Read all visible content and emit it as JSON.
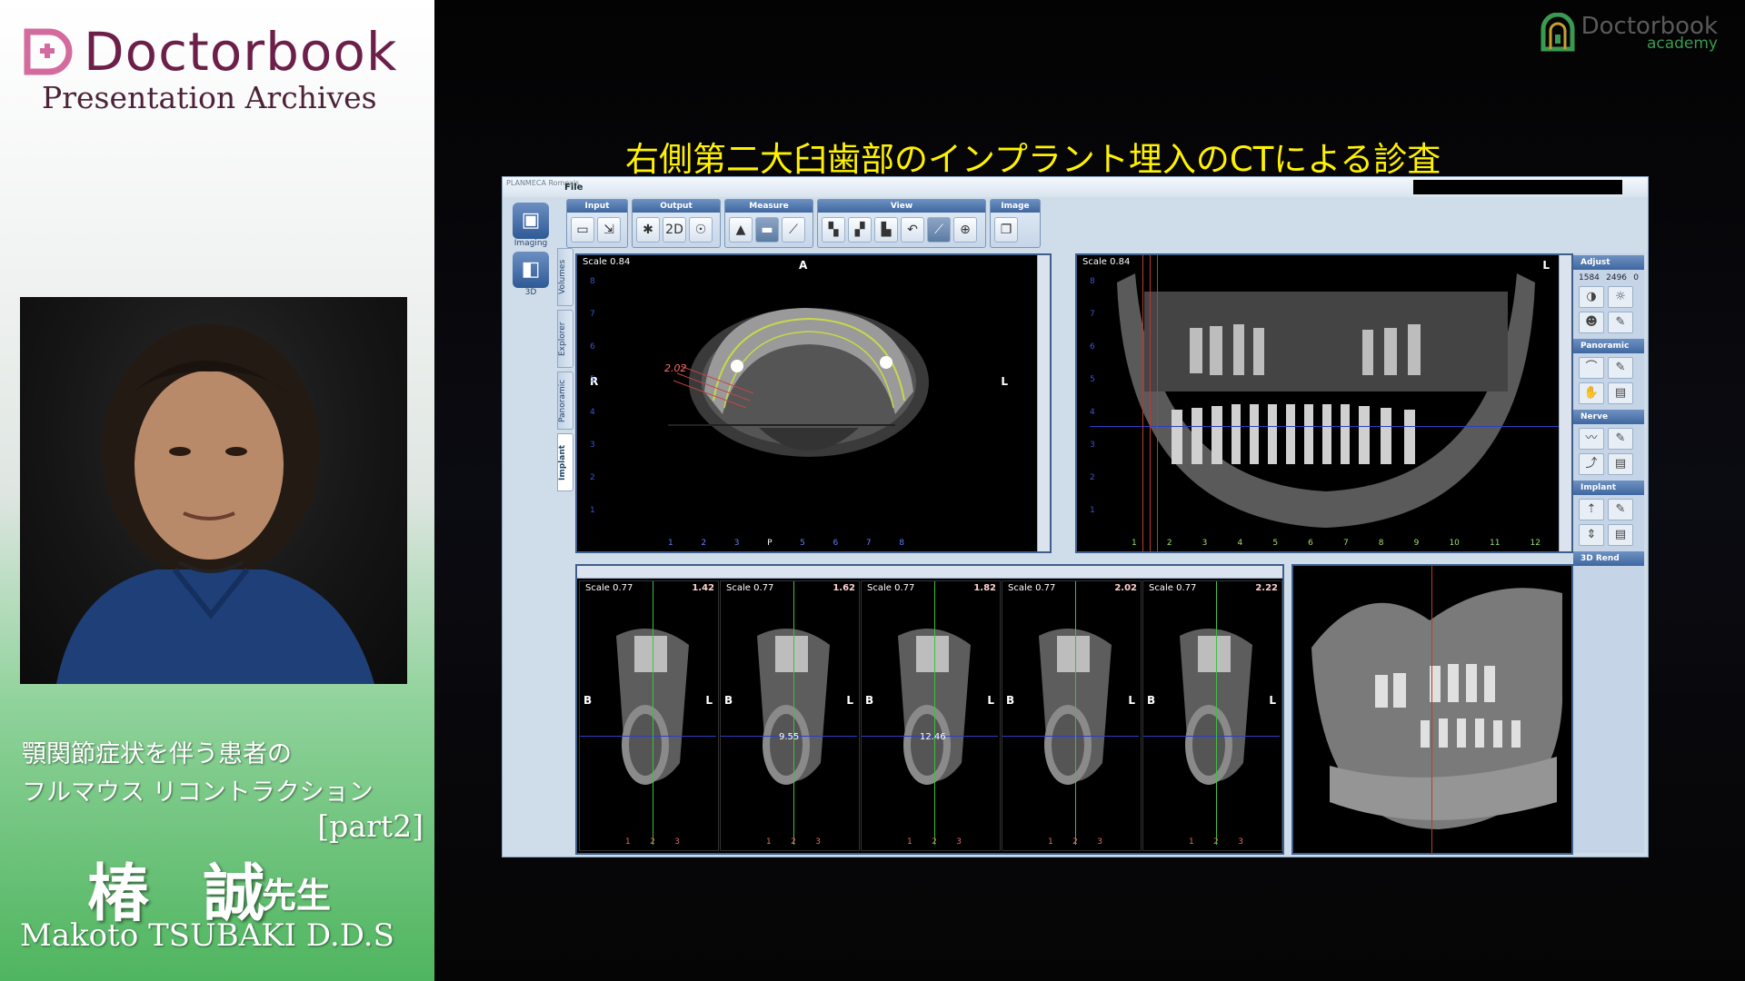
{
  "branding": {
    "name": "Doctorbook",
    "subtitle": "Presentation Archives",
    "academy_line1": "Doctorbook",
    "academy_line2": "academy"
  },
  "talk": {
    "title_line1": "顎関節症状を伴う患者の",
    "title_line2": "フルマウス リコントラクション",
    "part": "[part2]",
    "presenter_ja": "椿 誠",
    "honorific": "先生",
    "presenter_en": "Makoto TSUBAKI D.D.S"
  },
  "slide": {
    "title": "右側第二大臼歯部のインプラント埋入のCTによる診査"
  },
  "app": {
    "vendor": "PLANMECA Romexis",
    "menu": {
      "file": "File"
    },
    "toolbar_groups": [
      {
        "label": "Input",
        "buttons": [
          "open-folder-icon",
          "import-icon"
        ]
      },
      {
        "label": "Output",
        "buttons": [
          "xray-icon",
          "2d-icon",
          "skull-icon"
        ]
      },
      {
        "label": "Measure",
        "buttons": [
          "image-icon",
          "window-icon",
          "measure-icon"
        ]
      },
      {
        "label": "View",
        "buttons": [
          "layout1-icon",
          "layout2-icon",
          "layout3-icon",
          "layout4-icon",
          "ruler-icon",
          "zoom-icon"
        ]
      },
      {
        "label": "Image",
        "buttons": [
          "image-copy-icon"
        ]
      }
    ],
    "left_tools": [
      {
        "label": "Imaging",
        "icon": "imaging-icon"
      },
      {
        "label": "3D",
        "icon": "3d-icon"
      }
    ],
    "vertical_tabs": [
      "Volumes",
      "Explorer",
      "Panoramic",
      "Implant"
    ],
    "active_tab": "Implant",
    "axial_view": {
      "scale": "Scale 0.84",
      "orient_top": "A",
      "orient_left": "R",
      "orient_right": "L",
      "orient_bottom": "P",
      "measure": "2.02",
      "ticks_v": [
        "8",
        "7",
        "6",
        "5",
        "4",
        "3",
        "2",
        "1"
      ],
      "ticks_h": [
        "1",
        "2",
        "3",
        "P",
        "5",
        "6",
        "7",
        "8"
      ]
    },
    "pano_view": {
      "scale": "Scale 0.84",
      "orient_right": "L",
      "ticks_v": [
        "8",
        "7",
        "6",
        "5",
        "4",
        "3",
        "2",
        "1"
      ],
      "ticks_h": [
        "1",
        "2",
        "3",
        "4",
        "5",
        "6",
        "7",
        "8",
        "9",
        "10",
        "11",
        "12"
      ]
    },
    "cross_sections": [
      {
        "scale": "Scale 0.77",
        "pos": "1.42",
        "measure": ""
      },
      {
        "scale": "Scale 0.77",
        "pos": "1.62",
        "measure": "9.55"
      },
      {
        "scale": "Scale 0.77",
        "pos": "1.82",
        "measure": "12.46"
      },
      {
        "scale": "Scale 0.77",
        "pos": "2.02",
        "measure": ""
      },
      {
        "scale": "Scale 0.77",
        "pos": "2.22",
        "measure": ""
      }
    ],
    "cs_orient_left": "B",
    "cs_orient_right": "L",
    "cs_ticks_h": [
      "1",
      "2",
      "3"
    ],
    "right_panel": {
      "adjust": {
        "label": "Adjust",
        "values": [
          "1584",
          "2496",
          "0"
        ]
      },
      "panoramic": "Panoramic",
      "nerve": "Nerve",
      "implant": "Implant",
      "rend3d": "3D Rend"
    }
  }
}
